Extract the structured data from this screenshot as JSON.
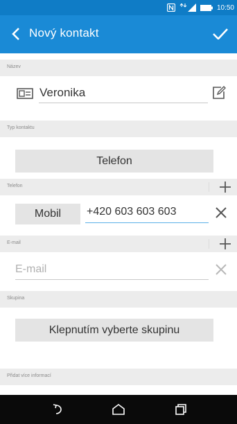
{
  "status_bar": {
    "time": "10:50",
    "icons": [
      "nfc-icon",
      "signal-icon",
      "battery-icon"
    ]
  },
  "app_bar": {
    "title": "Nový kontakt",
    "back_icon": "chevron-left-icon",
    "confirm_icon": "checkmark-icon"
  },
  "sections": {
    "name": {
      "label": "Název",
      "value": "Veronika"
    },
    "contact_type": {
      "label": "Typ kontaktu",
      "button": "Telefon"
    },
    "phone": {
      "label": "Telefon",
      "type_button": "Mobil",
      "value": "+420 603 603 603"
    },
    "email": {
      "label": "E-mail",
      "placeholder": "E-mail"
    },
    "group": {
      "label": "Skupina",
      "button": "Klepnutím vyberte skupinu"
    },
    "more_info": {
      "label": "Přidat více informací"
    }
  },
  "colors": {
    "status_bar": "#0f7cc6",
    "app_bar": "#1a8ad6",
    "active_underline": "#5bb0e8",
    "section_header": "#ececec",
    "nav_bar": "#0a0a0a"
  },
  "nav_bar": {
    "icons": [
      "back-icon",
      "home-icon",
      "recents-icon"
    ]
  }
}
